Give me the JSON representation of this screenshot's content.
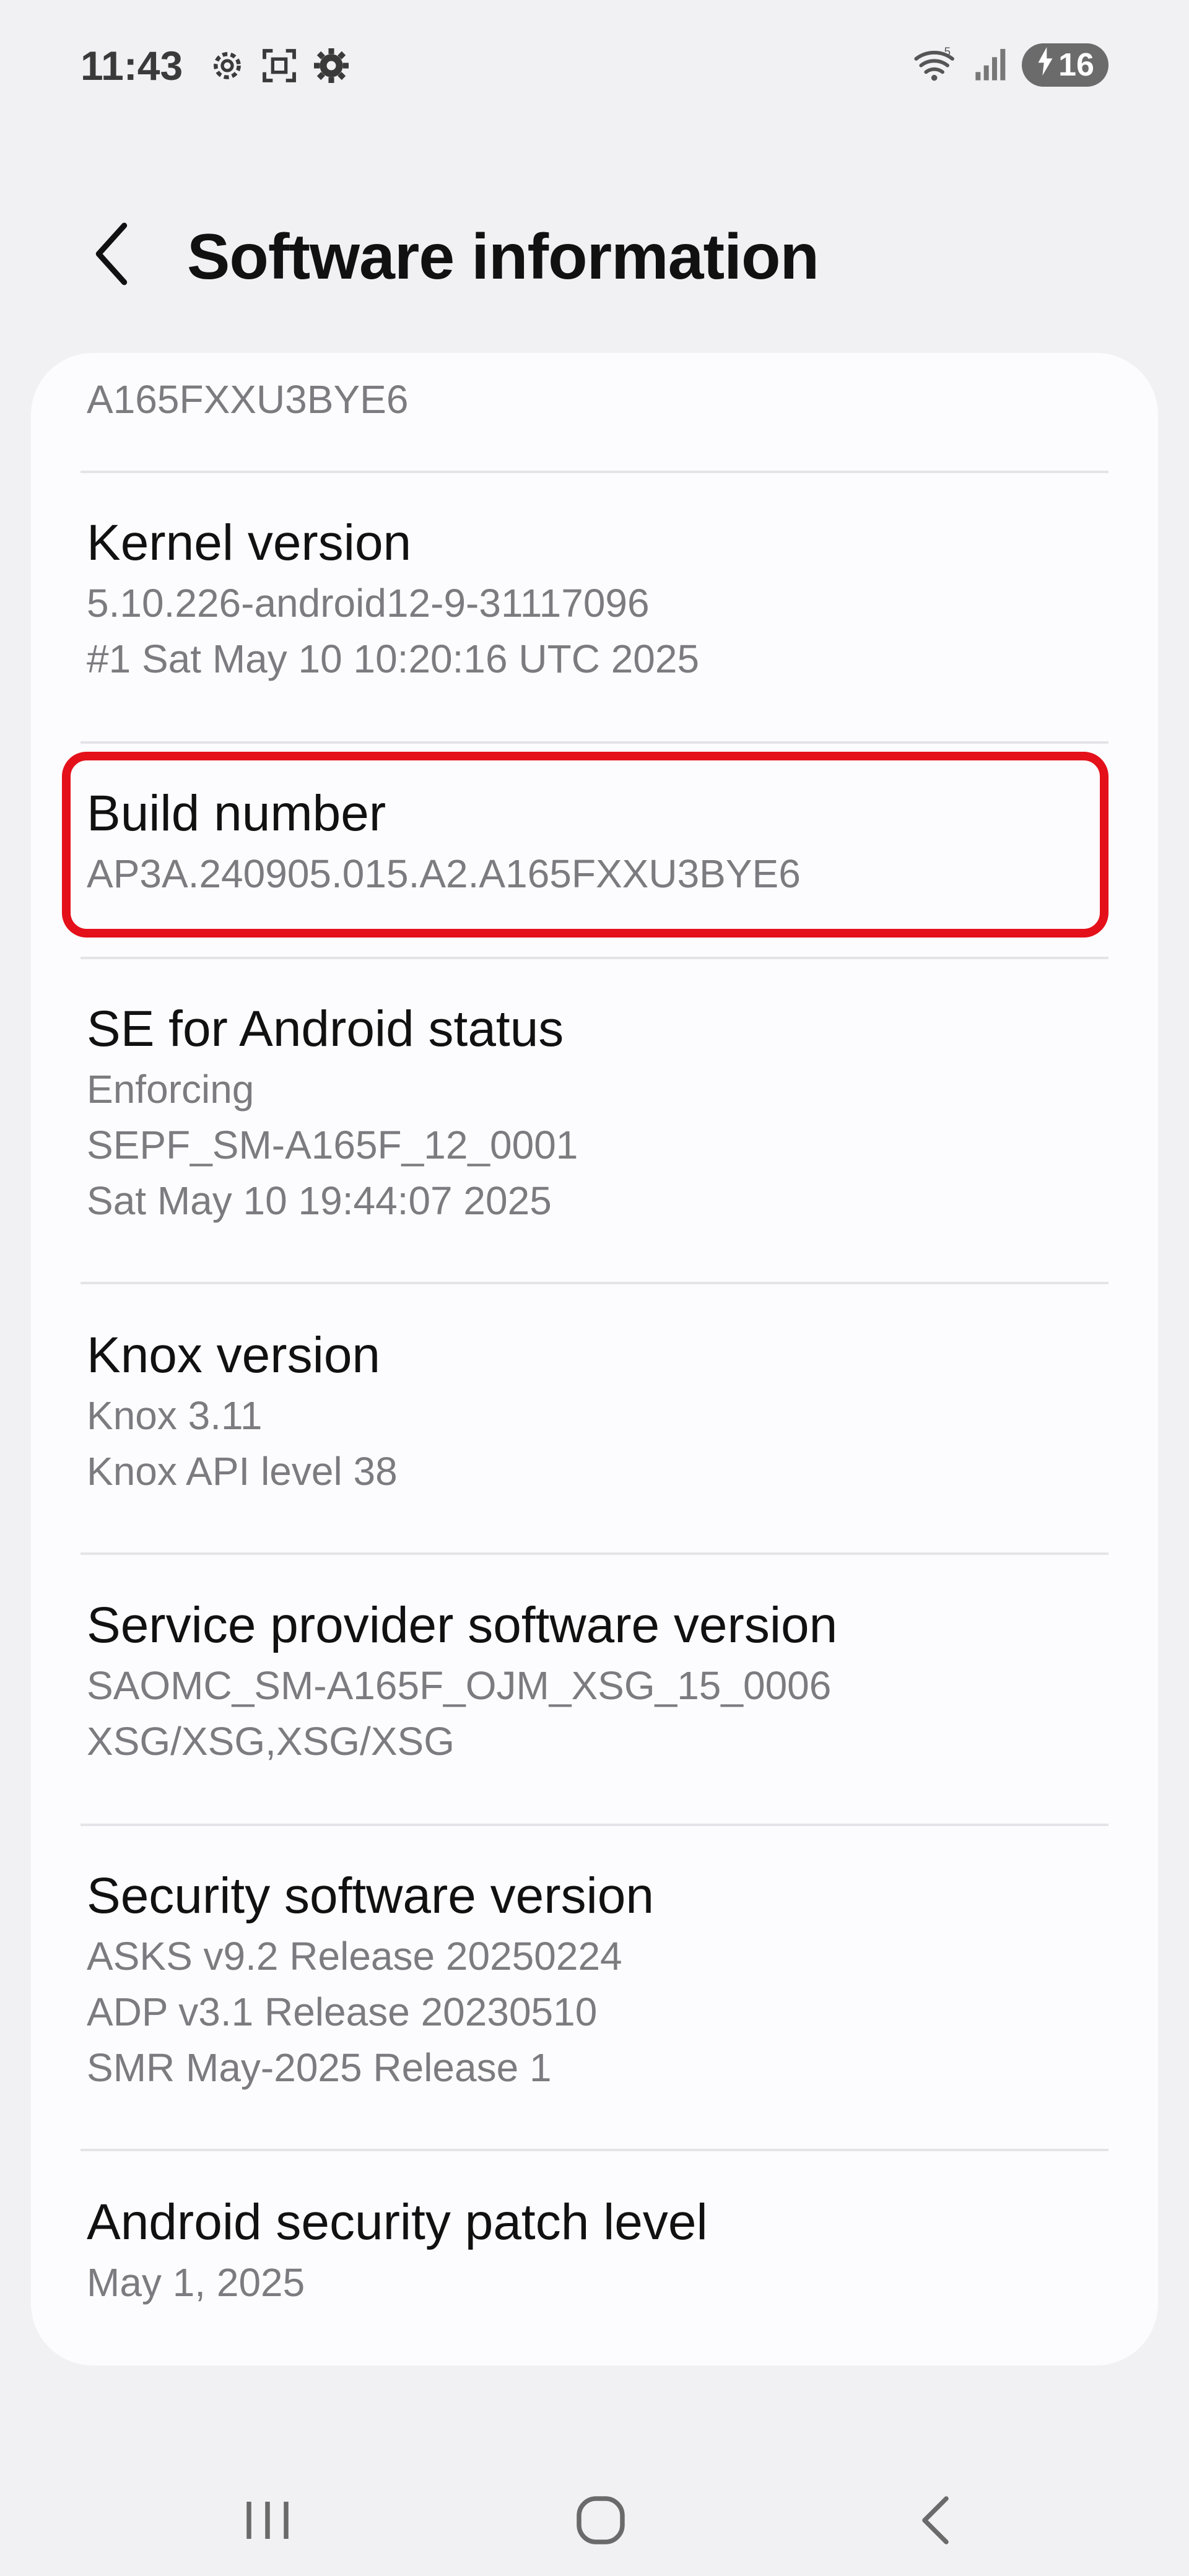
{
  "status": {
    "time": "11:43",
    "battery": "16"
  },
  "header": {
    "title": "Software information"
  },
  "items": [
    {
      "value": "A165FXXU3BYE6"
    },
    {
      "label": "Kernel version",
      "value": "5.10.226-android12-9-31117096\n#1 Sat May 10 10:20:16 UTC 2025"
    },
    {
      "label": "Build number",
      "value": "AP3A.240905.015.A2.A165FXXU3BYE6"
    },
    {
      "label": "SE for Android status",
      "value": "Enforcing\nSEPF_SM-A165F_12_0001\nSat May 10 19:44:07 2025"
    },
    {
      "label": "Knox version",
      "value": "Knox 3.11\nKnox API level 38"
    },
    {
      "label": "Service provider software version",
      "value": "SAOMC_SM-A165F_OJM_XSG_15_0006\nXSG/XSG,XSG/XSG"
    },
    {
      "label": "Security software version",
      "value": "ASKS v9.2  Release 20250224\nADP v3.1 Release 20230510\nSMR May-2025 Release 1"
    },
    {
      "label": "Android security patch level",
      "value": "May 1, 2025"
    }
  ],
  "icons": {
    "status_left": [
      "settings-gear-outline-icon",
      "screenshot-icon",
      "settings-gear-icon"
    ],
    "status_right": [
      "wifi-icon",
      "signal-icon",
      "battery-charging-icon"
    ],
    "nav": [
      "recent-apps-icon",
      "home-icon",
      "back-icon"
    ]
  },
  "colors": {
    "background": "#f1f1f4",
    "card": "#fcfcfe",
    "highlight": "#e4101a",
    "secondary_text": "#7b7b80"
  }
}
